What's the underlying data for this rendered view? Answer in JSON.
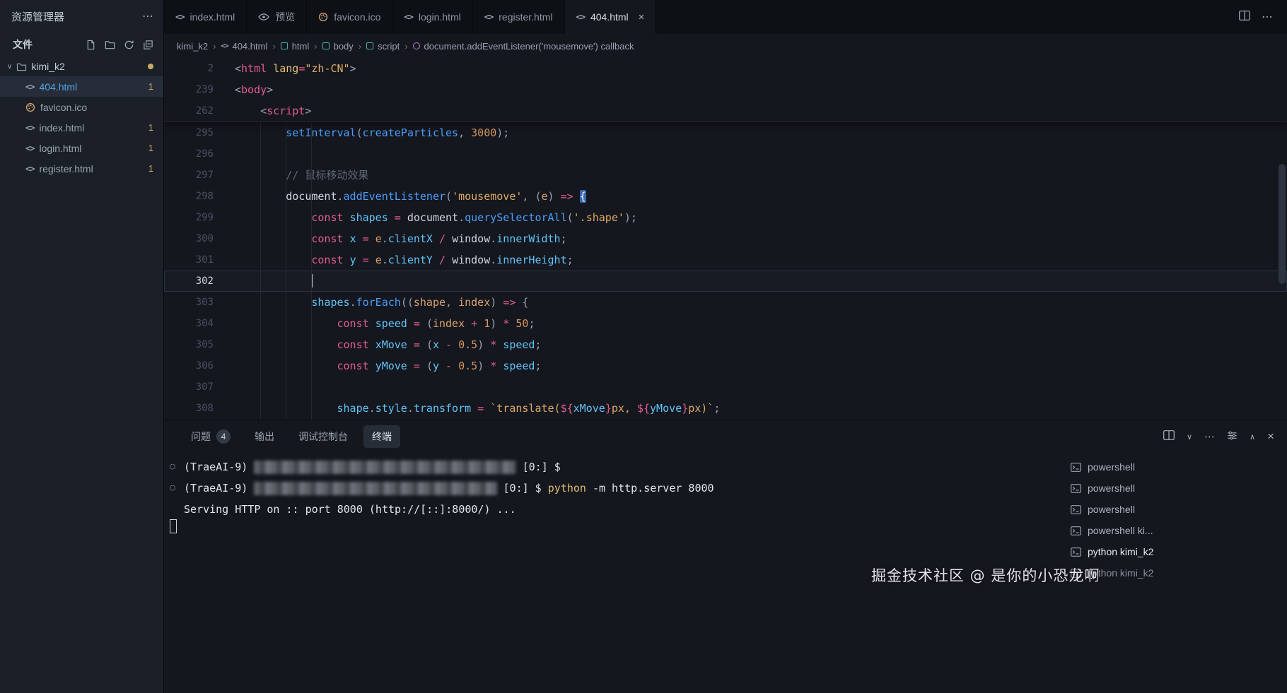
{
  "colors": {
    "accent_blue": "#4b9ef9",
    "active_file_blue": "#4fa6f0",
    "badge_yellow": "#c9a96a",
    "keyword_pink": "#e35d90",
    "string_orange": "#e0aa66",
    "editor_background": "#14171e",
    "sidebar_background": "#1b2028"
  },
  "explorer": {
    "title": "资源管理器",
    "section": "文件",
    "folder": "kimi_k2",
    "files": [
      {
        "name": "404.html",
        "icon": "html",
        "badge": "1",
        "active": true
      },
      {
        "name": "favicon.ico",
        "icon": "palette",
        "badge": ""
      },
      {
        "name": "index.html",
        "icon": "html",
        "badge": "1"
      },
      {
        "name": "login.html",
        "icon": "html",
        "badge": "1"
      },
      {
        "name": "register.html",
        "icon": "html",
        "badge": "1"
      }
    ]
  },
  "tabs": [
    {
      "label": "index.html",
      "icon": "html"
    },
    {
      "label": "预览",
      "icon": "eye"
    },
    {
      "label": "favicon.ico",
      "icon": "palette"
    },
    {
      "label": "login.html",
      "icon": "html"
    },
    {
      "label": "register.html",
      "icon": "html"
    },
    {
      "label": "404.html",
      "icon": "html",
      "active": true
    }
  ],
  "breadcrumb": [
    {
      "label": "kimi_k2"
    },
    {
      "label": "404.html",
      "icon": "html"
    },
    {
      "label": "html",
      "icon": "element"
    },
    {
      "label": "body",
      "icon": "element"
    },
    {
      "label": "script",
      "icon": "element"
    },
    {
      "label": "document.addEventListener('mousemove') callback",
      "icon": "symbol"
    }
  ],
  "editor": {
    "sticky_lines": [
      {
        "num": "2",
        "tokens": [
          [
            "pu",
            "<"
          ],
          [
            "tag",
            "html"
          ],
          [
            "pl",
            " "
          ],
          [
            "attr",
            "lang"
          ],
          [
            "op",
            "="
          ],
          [
            "str",
            "\"zh-CN\""
          ],
          [
            "pu",
            ">"
          ]
        ]
      },
      {
        "num": "239",
        "tokens": [
          [
            "pu",
            "<"
          ],
          [
            "tag",
            "body"
          ],
          [
            "pu",
            ">"
          ]
        ]
      },
      {
        "num": "262",
        "tokens": [
          [
            "pl",
            "    "
          ],
          [
            "pu",
            "<"
          ],
          [
            "tag",
            "script"
          ],
          [
            "pu",
            ">"
          ]
        ]
      }
    ],
    "lines": [
      {
        "num": "295",
        "tokens": [
          [
            "pl",
            "        "
          ],
          [
            "fn",
            "setInterval"
          ],
          [
            "pu",
            "("
          ],
          [
            "fn",
            "createParticles"
          ],
          [
            "pu",
            ","
          ],
          [
            "pl",
            " "
          ],
          [
            "num",
            "3000"
          ],
          [
            "pu",
            ");"
          ]
        ]
      },
      {
        "num": "296",
        "tokens": []
      },
      {
        "num": "297",
        "tokens": [
          [
            "pl",
            "        "
          ],
          [
            "cmt",
            "// 鼠标移动效果"
          ]
        ]
      },
      {
        "num": "298",
        "tokens": [
          [
            "pl",
            "        "
          ],
          [
            "obj",
            "document"
          ],
          [
            "pu",
            "."
          ],
          [
            "fn",
            "addEventListener"
          ],
          [
            "pu",
            "("
          ],
          [
            "str",
            "'mousemove'"
          ],
          [
            "pu",
            ","
          ],
          [
            "pl",
            " "
          ],
          [
            "pu",
            "("
          ],
          [
            "par",
            "e"
          ],
          [
            "pu",
            ")"
          ],
          [
            "pl",
            " "
          ],
          [
            "kw",
            "=>"
          ],
          [
            "pl",
            " "
          ],
          [
            "hl",
            "{"
          ]
        ]
      },
      {
        "num": "299",
        "tokens": [
          [
            "pl",
            "            "
          ],
          [
            "kw",
            "const"
          ],
          [
            "pl",
            " "
          ],
          [
            "var",
            "shapes"
          ],
          [
            "pl",
            " "
          ],
          [
            "op",
            "="
          ],
          [
            "pl",
            " "
          ],
          [
            "obj",
            "document"
          ],
          [
            "pu",
            "."
          ],
          [
            "fn",
            "querySelectorAll"
          ],
          [
            "pu",
            "("
          ],
          [
            "str",
            "'.shape'"
          ],
          [
            "pu",
            ");"
          ]
        ]
      },
      {
        "num": "300",
        "tokens": [
          [
            "pl",
            "            "
          ],
          [
            "kw",
            "const"
          ],
          [
            "pl",
            " "
          ],
          [
            "var",
            "x"
          ],
          [
            "pl",
            " "
          ],
          [
            "op",
            "="
          ],
          [
            "pl",
            " "
          ],
          [
            "par",
            "e"
          ],
          [
            "pu",
            "."
          ],
          [
            "prop",
            "clientX"
          ],
          [
            "pl",
            " "
          ],
          [
            "op",
            "/"
          ],
          [
            "pl",
            " "
          ],
          [
            "obj",
            "window"
          ],
          [
            "pu",
            "."
          ],
          [
            "prop",
            "innerWidth"
          ],
          [
            "pu",
            ";"
          ]
        ]
      },
      {
        "num": "301",
        "tokens": [
          [
            "pl",
            "            "
          ],
          [
            "kw",
            "const"
          ],
          [
            "pl",
            " "
          ],
          [
            "var",
            "y"
          ],
          [
            "pl",
            " "
          ],
          [
            "op",
            "="
          ],
          [
            "pl",
            " "
          ],
          [
            "par",
            "e"
          ],
          [
            "pu",
            "."
          ],
          [
            "prop",
            "clientY"
          ],
          [
            "pl",
            " "
          ],
          [
            "op",
            "/"
          ],
          [
            "pl",
            " "
          ],
          [
            "obj",
            "window"
          ],
          [
            "pu",
            "."
          ],
          [
            "prop",
            "innerHeight"
          ],
          [
            "pu",
            ";"
          ]
        ]
      },
      {
        "num": "302",
        "cursor": true,
        "cursor_col": 12,
        "tokens": []
      },
      {
        "num": "303",
        "tokens": [
          [
            "pl",
            "            "
          ],
          [
            "var",
            "shapes"
          ],
          [
            "pu",
            "."
          ],
          [
            "fn",
            "forEach"
          ],
          [
            "pu",
            "(("
          ],
          [
            "par",
            "shape"
          ],
          [
            "pu",
            ","
          ],
          [
            "pl",
            " "
          ],
          [
            "par",
            "index"
          ],
          [
            "pu",
            ")"
          ],
          [
            "pl",
            " "
          ],
          [
            "kw",
            "=>"
          ],
          [
            "pl",
            " "
          ],
          [
            "pu",
            "{"
          ]
        ]
      },
      {
        "num": "304",
        "tokens": [
          [
            "pl",
            "                "
          ],
          [
            "kw",
            "const"
          ],
          [
            "pl",
            " "
          ],
          [
            "var",
            "speed"
          ],
          [
            "pl",
            " "
          ],
          [
            "op",
            "="
          ],
          [
            "pl",
            " "
          ],
          [
            "pu",
            "("
          ],
          [
            "par",
            "index"
          ],
          [
            "pl",
            " "
          ],
          [
            "op",
            "+"
          ],
          [
            "pl",
            " "
          ],
          [
            "num",
            "1"
          ],
          [
            "pu",
            ")"
          ],
          [
            "pl",
            " "
          ],
          [
            "op",
            "*"
          ],
          [
            "pl",
            " "
          ],
          [
            "num",
            "50"
          ],
          [
            "pu",
            ";"
          ]
        ]
      },
      {
        "num": "305",
        "tokens": [
          [
            "pl",
            "                "
          ],
          [
            "kw",
            "const"
          ],
          [
            "pl",
            " "
          ],
          [
            "var",
            "xMove"
          ],
          [
            "pl",
            " "
          ],
          [
            "op",
            "="
          ],
          [
            "pl",
            " "
          ],
          [
            "pu",
            "("
          ],
          [
            "var",
            "x"
          ],
          [
            "pl",
            " "
          ],
          [
            "op",
            "-"
          ],
          [
            "pl",
            " "
          ],
          [
            "num",
            "0.5"
          ],
          [
            "pu",
            ")"
          ],
          [
            "pl",
            " "
          ],
          [
            "op",
            "*"
          ],
          [
            "pl",
            " "
          ],
          [
            "var",
            "speed"
          ],
          [
            "pu",
            ";"
          ]
        ]
      },
      {
        "num": "306",
        "tokens": [
          [
            "pl",
            "                "
          ],
          [
            "kw",
            "const"
          ],
          [
            "pl",
            " "
          ],
          [
            "var",
            "yMove"
          ],
          [
            "pl",
            " "
          ],
          [
            "op",
            "="
          ],
          [
            "pl",
            " "
          ],
          [
            "pu",
            "("
          ],
          [
            "var",
            "y"
          ],
          [
            "pl",
            " "
          ],
          [
            "op",
            "-"
          ],
          [
            "pl",
            " "
          ],
          [
            "num",
            "0.5"
          ],
          [
            "pu",
            ")"
          ],
          [
            "pl",
            " "
          ],
          [
            "op",
            "*"
          ],
          [
            "pl",
            " "
          ],
          [
            "var",
            "speed"
          ],
          [
            "pu",
            ";"
          ]
        ]
      },
      {
        "num": "307",
        "tokens": []
      },
      {
        "num": "308",
        "tokens": [
          [
            "pl",
            "                "
          ],
          [
            "var",
            "shape"
          ],
          [
            "pu",
            "."
          ],
          [
            "prop",
            "style"
          ],
          [
            "pu",
            "."
          ],
          [
            "prop",
            "transform"
          ],
          [
            "pl",
            " "
          ],
          [
            "op",
            "="
          ],
          [
            "pl",
            " "
          ],
          [
            "str",
            "`translate("
          ],
          [
            "kw",
            "${"
          ],
          [
            "var",
            "xMove"
          ],
          [
            "kw",
            "}"
          ],
          [
            "str",
            "px, "
          ],
          [
            "kw",
            "${"
          ],
          [
            "var",
            "yMove"
          ],
          [
            "kw",
            "}"
          ],
          [
            "str",
            "px)`"
          ],
          [
            "pu",
            ";"
          ]
        ]
      }
    ]
  },
  "panel": {
    "tabs": [
      {
        "label": "问题",
        "badge": "4"
      },
      {
        "label": "输出"
      },
      {
        "label": "调试控制台"
      },
      {
        "label": "终端",
        "active": true
      }
    ],
    "terminal": {
      "lines": [
        {
          "marker": "○",
          "tokens": [
            [
              "pl",
              "(TraeAI-9) "
            ],
            [
              "redact",
              "41"
            ],
            [
              "pl",
              " [0:] $"
            ]
          ]
        },
        {
          "marker": "○",
          "tokens": [
            [
              "pl",
              "(TraeAI-9) "
            ],
            [
              "redact",
              "38"
            ],
            [
              "pl",
              " [0:] $ "
            ],
            [
              "cmd",
              "python"
            ],
            [
              "pl",
              " -m http.server 8000"
            ]
          ]
        },
        {
          "marker": "",
          "tokens": [
            [
              "pl",
              "Serving HTTP on :: port 8000 (http://[::]:8000/) ..."
            ]
          ]
        },
        {
          "marker": "",
          "cursor": true,
          "tokens": []
        }
      ]
    },
    "terminal_list": [
      {
        "label": "powershell"
      },
      {
        "label": "powershell"
      },
      {
        "label": "powershell"
      },
      {
        "label": "powershell ki..."
      },
      {
        "label": "python kimi_k2",
        "active": true
      },
      {
        "label": "python kimi_k2",
        "dim": true
      }
    ]
  },
  "watermark": "掘金技术社区 @ 是你的小恐龙啊"
}
